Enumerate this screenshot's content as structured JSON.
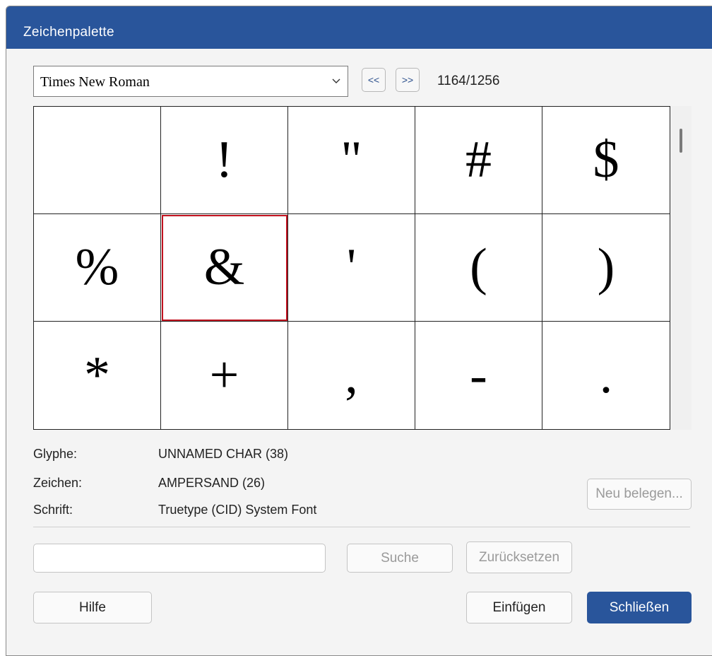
{
  "window": {
    "title": "Zeichenpalette"
  },
  "font_select": {
    "value": "Times New Roman"
  },
  "nav": {
    "prev_label": "<<",
    "next_label": ">>",
    "position": "1164/1256"
  },
  "glyph_grid": {
    "cells": [
      " ",
      "!",
      "\"",
      "#",
      "$",
      "%",
      "&",
      "'",
      "(",
      ")",
      "*",
      "+",
      ",",
      "-",
      "."
    ],
    "selected_index": 6
  },
  "info": {
    "glyph_label": "Glyphe:",
    "glyph_value": "UNNAMED CHAR (38)",
    "char_label": "Zeichen:",
    "char_value": "AMPERSAND (26)",
    "font_label": "Schrift:",
    "font_value": "Truetype (CID) System Font"
  },
  "buttons": {
    "reassign": "Neu belegen...",
    "search": "Suche",
    "reset": "Zurücksetzen",
    "help": "Hilfe",
    "insert": "Einfügen",
    "close": "Schließen"
  },
  "search": {
    "value": "",
    "placeholder": ""
  },
  "colors": {
    "title_bar": "#29559b",
    "selection": "#c1121f",
    "primary_button": "#29559b"
  },
  "icons": {
    "dropdown": "chevron-down-icon"
  }
}
